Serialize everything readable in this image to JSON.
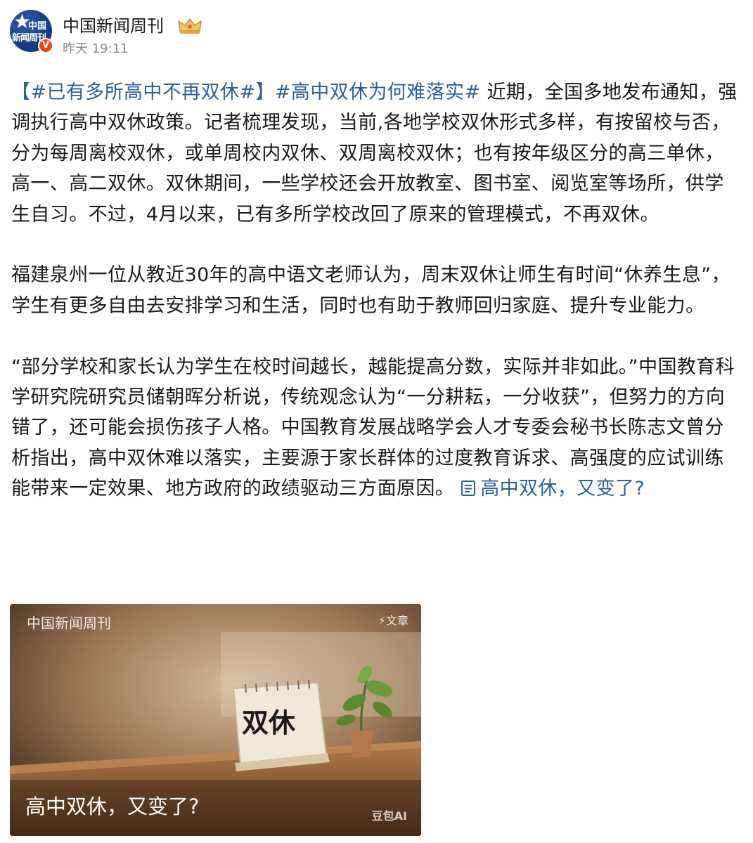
{
  "account": {
    "avatar_text_line1": "中国",
    "avatar_text_line2": "新闻周刊",
    "verified_badge": "V",
    "name": "中国新闻周刊",
    "time": "昨天 19:11"
  },
  "post": {
    "tag1": "【#已有多所高中不再双休#】",
    "tag2": "#高中双休为何难落实#",
    "para1_rest": "近期，全国多地发布通知，强调执行高中双休政策。记者梳理发现，当前,各地学校双休形式多样，有按留校与否，分为每周离校双休，或单周校内双休、双周离校双休；也有按年级区分的高三单休，高一、高二双休。双休期间，一些学校还会开放教室、图书室、阅览室等场所，供学生自习。不过，4月以来，已有多所学校改回了原来的管理模式，不再双休。",
    "para2": "福建泉州一位从教近30年的高中语文老师认为，周末双休让师生有时间“休养生息”，学生有更多自由去安排学习和生活，同时也有助于教师回归家庭、提升专业能力。",
    "para3": "“部分学校和家长认为学生在校时间越长，越能提高分数，实际并非如此。”中国教育科学研究院研究员储朝晖分析说，传统观念认为“一分耕耘，一分收获”，但努力的方向错了，还可能会损伤孩子人格。中国教育发展战略学会人才专委会秘书长陈志文曾分析指出，高中双休难以落实，主要源于家长群体的过度教育诉求、高强度的应试训练能带来一定效果、地方政府的政绩驱动三方面原因。",
    "article_link": "高中双休，又变了?"
  },
  "card": {
    "label": "中国新闻周刊",
    "badge": "⚡文章",
    "calendar_text": "双休",
    "title": "高中双休，又变了?",
    "watermark": "豆包AI"
  },
  "colors": {
    "link": "#2f5f99",
    "text": "#1a1a1a",
    "meta": "#8a8a8a",
    "verified": "#f5421c"
  },
  "icons": {
    "avatar_star": "star-icon",
    "crown": "crown-icon",
    "article": "article-icon"
  }
}
